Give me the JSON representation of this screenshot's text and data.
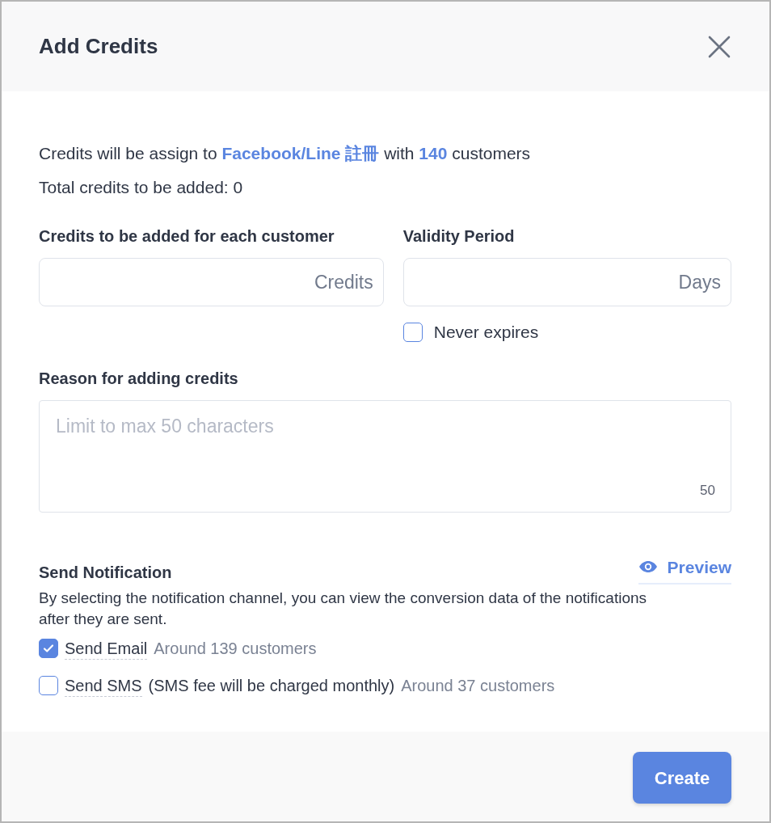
{
  "dialog": {
    "title": "Add Credits"
  },
  "summary": [
    "Credits will be assign to **Facebook/Line 註冊** with **140** customers",
    "Total credits to be added: 0"
  ],
  "fields": [
    {
      "label": "Credits to be added for each customer",
      "unit": "Credits"
    },
    {
      "label": "Validity Period",
      "unit": "Days"
    }
  ],
  "never_expires": {
    "label": "Never expires",
    "checked": false
  },
  "reason": {
    "label": "Reason for adding credits",
    "placeholder": "Limit to max 50 characters",
    "counter": "50"
  },
  "notification": {
    "title": "Send Notification",
    "preview": "Preview",
    "description": "By selecting the notification channel, you can view the conversion data of the notifications after they are sent.",
    "options": [
      {
        "label": "Send Email",
        "checked": true,
        "count": "Around 139 customers"
      },
      {
        "label": "Send SMS",
        "checked": false,
        "note": "(SMS fee will be charged monthly)",
        "count": "Around 37 customers"
      }
    ]
  },
  "footer": {
    "button": "Create"
  }
}
